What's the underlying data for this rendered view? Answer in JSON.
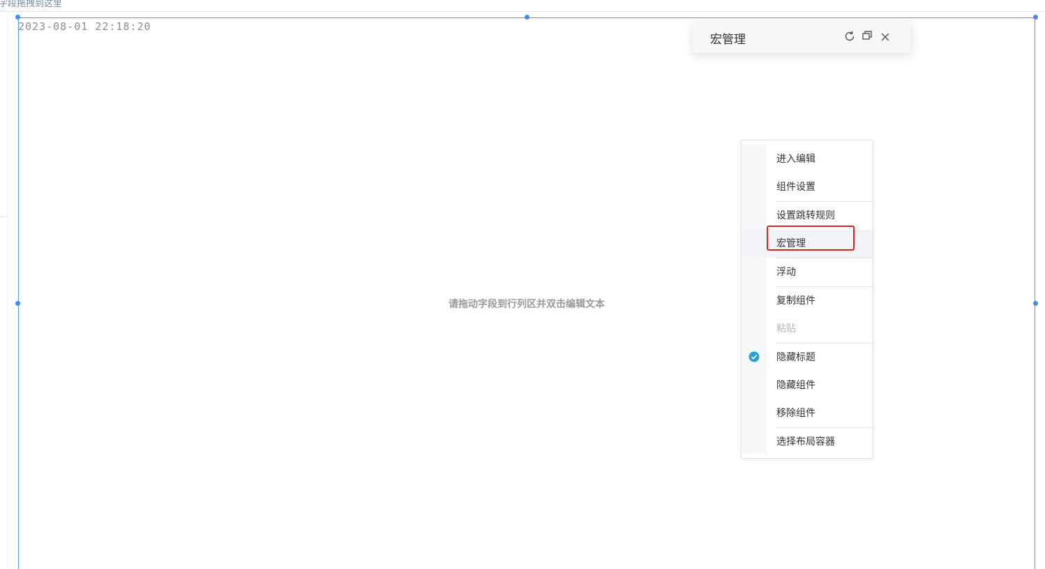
{
  "top_hint": "字段拖拽到这里",
  "widget": {
    "timestamp": "2023-08-01 22:18:20",
    "placeholder": "请拖动字段到行列区并双击编辑文本"
  },
  "macro_panel": {
    "title": "宏管理",
    "icons": [
      "refresh-icon",
      "restore-window-icon",
      "close-icon"
    ]
  },
  "context_menu": {
    "items": [
      {
        "label": "进入编辑"
      },
      {
        "label": "组件设置"
      },
      {
        "label": "设置跳转规则"
      },
      {
        "label": "宏管理",
        "highlighted": true,
        "annotated": true
      },
      {
        "label": "浮动"
      },
      {
        "label": "复制组件"
      },
      {
        "label": "粘贴",
        "disabled": true
      },
      {
        "label": "隐藏标题",
        "checked": true
      },
      {
        "label": "隐藏组件"
      },
      {
        "label": "移除组件"
      },
      {
        "label": "选择布局容器"
      }
    ]
  },
  "colors": {
    "selection_border": "#4f9cf0",
    "check_fill": "#2a9fd6",
    "annotation_red": "#e02020"
  }
}
